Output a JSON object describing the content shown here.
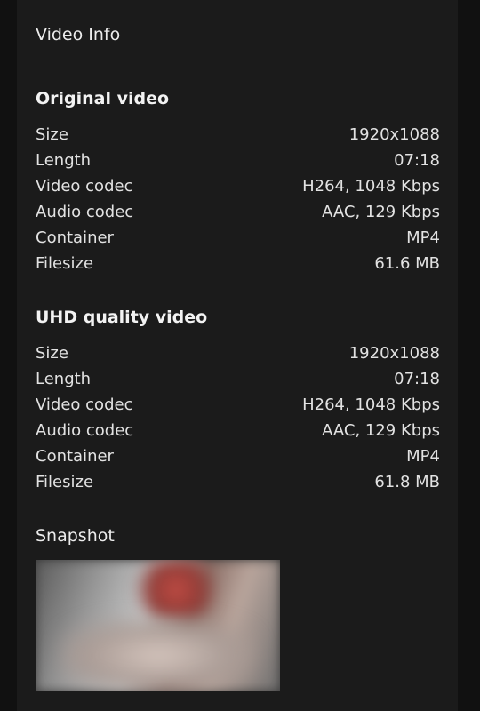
{
  "title": "Video Info",
  "original": {
    "heading": "Original video",
    "rows": [
      {
        "label": "Size",
        "value": "1920x1088"
      },
      {
        "label": "Length",
        "value": "07:18"
      },
      {
        "label": "Video codec",
        "value": "H264, 1048 Kbps"
      },
      {
        "label": "Audio codec",
        "value": "AAC, 129 Kbps"
      },
      {
        "label": "Container",
        "value": "MP4"
      },
      {
        "label": "Filesize",
        "value": "61.6 MB"
      }
    ]
  },
  "uhd": {
    "heading": "UHD quality video",
    "rows": [
      {
        "label": "Size",
        "value": "1920x1088"
      },
      {
        "label": "Length",
        "value": "07:18"
      },
      {
        "label": "Video codec",
        "value": "H264, 1048 Kbps"
      },
      {
        "label": "Audio codec",
        "value": "AAC, 129 Kbps"
      },
      {
        "label": "Container",
        "value": "MP4"
      },
      {
        "label": "Filesize",
        "value": "61.8 MB"
      }
    ]
  },
  "snapshot": {
    "label": "Snapshot"
  },
  "colors": {
    "background": "#111111",
    "panel": "#1b1b1b",
    "text": "#e6e6e6"
  }
}
